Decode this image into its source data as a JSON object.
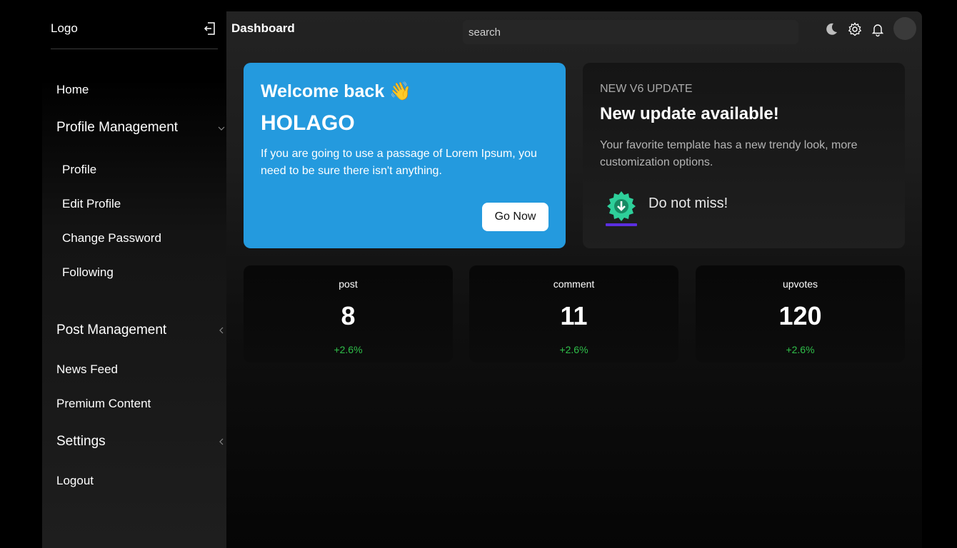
{
  "sidebar": {
    "logo": "Logo",
    "items": {
      "home": "Home",
      "profile_management": "Profile Management",
      "profile": "Profile",
      "edit_profile": "Edit Profile",
      "change_password": "Change Password",
      "following": "Following",
      "post_management": "Post Management",
      "news_feed": "News Feed",
      "premium_content": "Premium Content",
      "settings": "Settings",
      "logout": "Logout"
    }
  },
  "header": {
    "title": "Dashboard",
    "search_placeholder": "search",
    "icons": [
      "moon-icon",
      "gear-icon",
      "bell-icon",
      "avatar"
    ]
  },
  "welcome_card": {
    "greeting": "Welcome back 👋",
    "name": "HOLAGO",
    "text": "If you are going to use a passage of Lorem Ipsum, you need to be sure there isn't anything.",
    "button": "Go Now",
    "bg_color": "#249ade"
  },
  "update_card": {
    "eyebrow": "NEW V6 UPDATE",
    "title": "New update available!",
    "text": "Your favorite template has a new trendy look, more customization options.",
    "cta": "Do not miss!"
  },
  "stats": [
    {
      "label": "post",
      "value": "8",
      "change": "+2.6%"
    },
    {
      "label": "comment",
      "value": "11",
      "change": "+2.6%"
    },
    {
      "label": "upvotes",
      "value": "120",
      "change": "+2.6%"
    }
  ],
  "colors": {
    "positive": "#2fbf4a",
    "accent": "#249ade"
  }
}
